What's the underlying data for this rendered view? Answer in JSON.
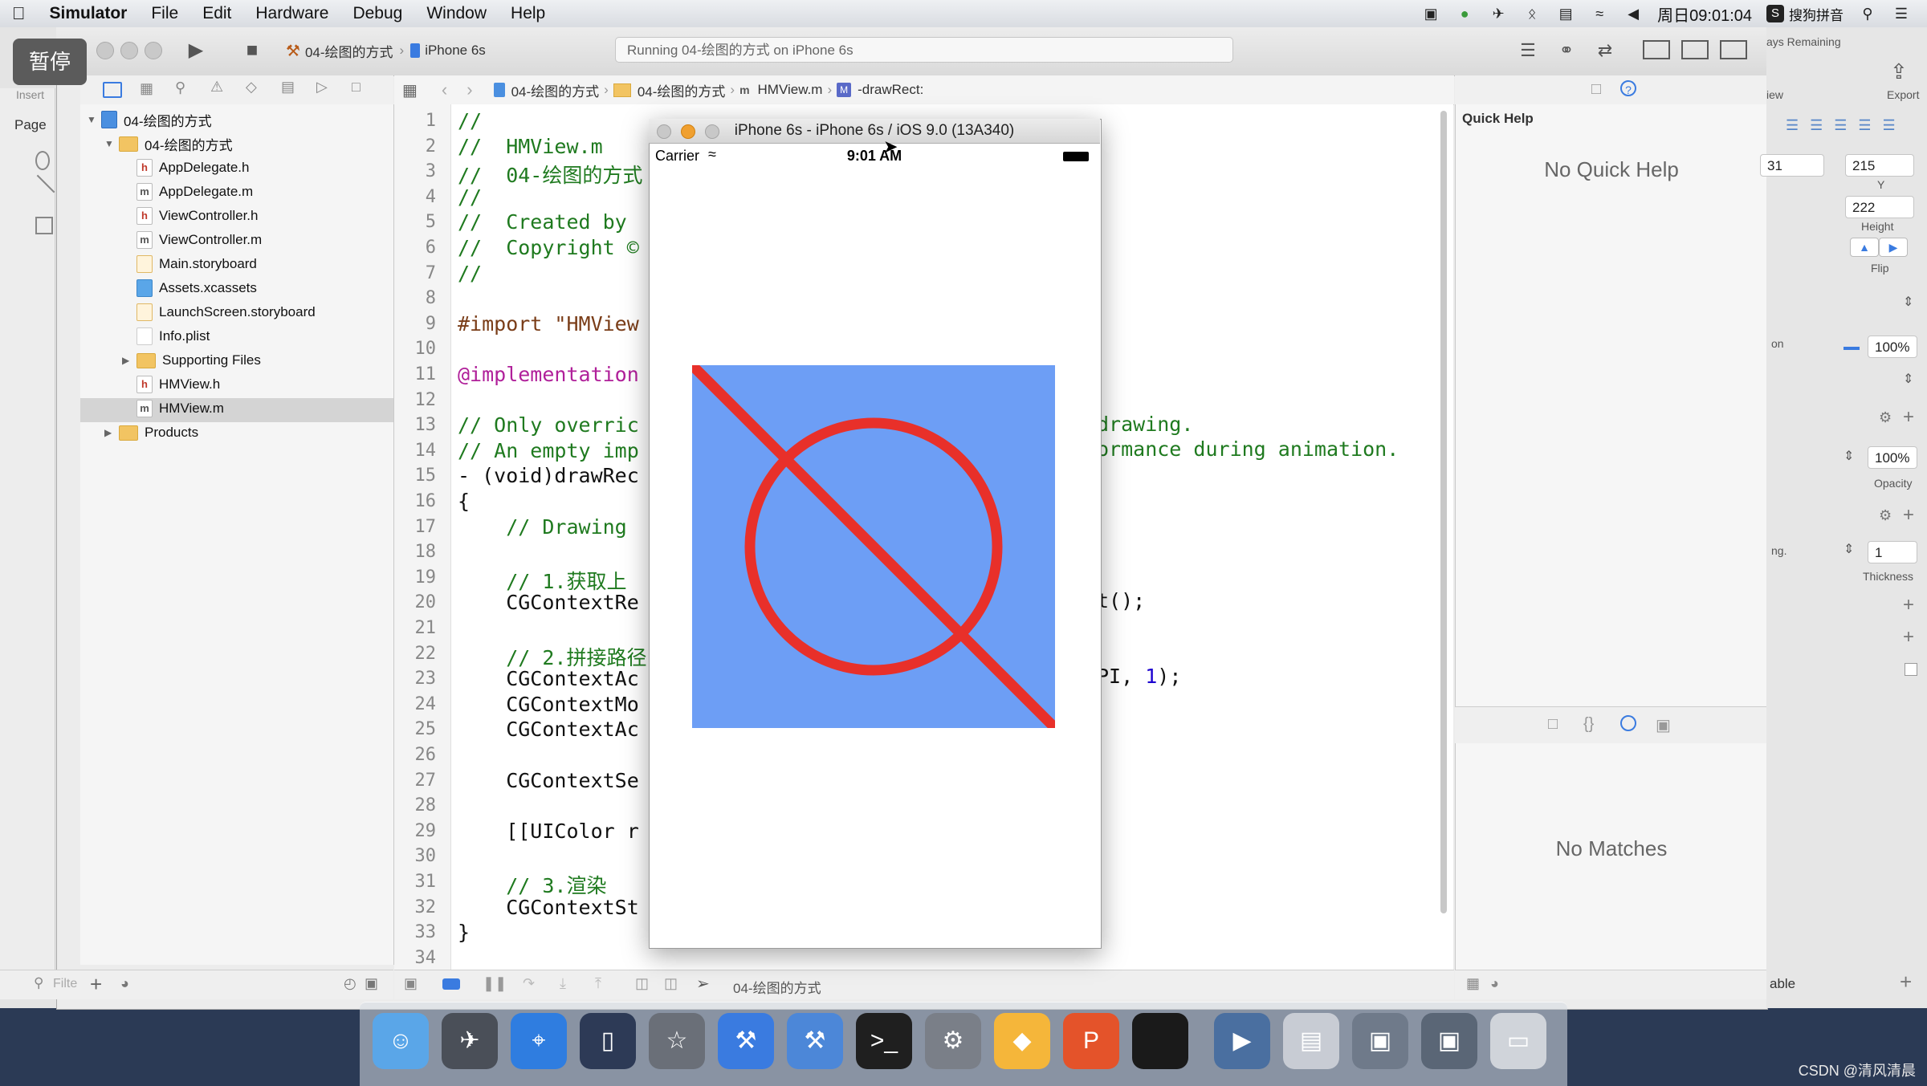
{
  "overlay": {
    "paused": "暂停"
  },
  "menubar": {
    "items": [
      "Simulator",
      "File",
      "Edit",
      "Hardware",
      "Debug",
      "Window",
      "Help"
    ],
    "clock": "周日09:01:04",
    "input_method": "搜狗拼音"
  },
  "toolbar": {
    "scheme_project": "04-绘图的方式",
    "scheme_device": "iPhone 6s",
    "activity": "Running 04-绘图的方式 on iPhone 6s"
  },
  "jumpbar": {
    "crumbs": [
      "04-绘图的方式",
      "04-绘图的方式",
      "HMView.m",
      "-drawRect:"
    ]
  },
  "navigator": {
    "items": [
      {
        "label": "04-绘图的方式",
        "icon": "project",
        "level": 0,
        "open": true
      },
      {
        "label": "04-绘图的方式",
        "icon": "folder",
        "level": 1,
        "open": true
      },
      {
        "label": "AppDelegate.h",
        "icon": "h",
        "level": 2
      },
      {
        "label": "AppDelegate.m",
        "icon": "m",
        "level": 2
      },
      {
        "label": "ViewController.h",
        "icon": "h",
        "level": 2
      },
      {
        "label": "ViewController.m",
        "icon": "m",
        "level": 2
      },
      {
        "label": "Main.storyboard",
        "icon": "storyboard",
        "level": 2
      },
      {
        "label": "Assets.xcassets",
        "icon": "assets",
        "level": 2
      },
      {
        "label": "LaunchScreen.storyboard",
        "icon": "storyboard",
        "level": 2
      },
      {
        "label": "Info.plist",
        "icon": "plist",
        "level": 2
      },
      {
        "label": "Supporting Files",
        "icon": "folder",
        "level": 2,
        "closed": true
      },
      {
        "label": "HMView.h",
        "icon": "h",
        "level": 2
      },
      {
        "label": "HMView.m",
        "icon": "m",
        "level": 2,
        "selected": true
      },
      {
        "label": "Products",
        "icon": "folder",
        "level": 1,
        "closed": true
      }
    ],
    "filter_placeholder": "Filte"
  },
  "left_strip": {
    "insert_label": "Insert",
    "page_label": "Page"
  },
  "editor": {
    "lines": [
      "//",
      "//  HMView.m",
      "//  04-绘图的方式",
      "//",
      "//  Created by",
      "//  Copyright ©",
      "//",
      "",
      "#import \"HMView",
      "",
      "@implementation",
      "",
      "// Only overric",
      "// An empty imp",
      "- (void)drawRec",
      "{",
      "    // Drawing",
      "",
      "    // 1.获取上",
      "    CGContextRe",
      "",
      "    // 2.拼接路径",
      "    CGContextAc",
      "    CGContextMo",
      "    CGContextAc",
      "",
      "    CGContextSe",
      "",
      "    [[UIColor r",
      "",
      "    // 3.渲染",
      "    CGContextSt",
      "}",
      ""
    ],
    "right_fragments": {
      "line13": "drawing.",
      "line14": "ormance during animation.",
      "line20": "t();",
      "line23_a": "PI, ",
      "line23_b": "1",
      "line23_c": ");"
    },
    "bottom_target": "04-绘图的方式"
  },
  "inspector": {
    "title": "Quick Help",
    "empty": "No Quick Help",
    "library_empty": "No Matches"
  },
  "right_panel": {
    "days_remaining": "ays Remaining",
    "export_label": "Export",
    "view_label": "iew",
    "x_value": "31",
    "y_value": "215",
    "y_label": "Y",
    "height_value": "222",
    "height_label": "Height",
    "flip_label": "Flip",
    "on_label": "on",
    "scale_1": "100%",
    "scale_2": "100%",
    "opacity_label": "Opacity",
    "thickness_value": "1",
    "thickness_label": "Thickness",
    "ng_label": "ng.",
    "able_label": "able"
  },
  "simulator": {
    "title": "iPhone 6s - iPhone 6s / iOS 9.0 (13A340)",
    "carrier": "Carrier",
    "time": "9:01 AM",
    "drawing": {
      "background": "#6d9ef5",
      "stroke": "#e8302a"
    }
  },
  "watermark": "CSDN @清风清晨",
  "dock": {
    "apps": [
      "finder-icon",
      "launchpad-icon",
      "safari-icon",
      "mouse-icon",
      "photo-icon",
      "xcode-icon",
      "instruments-icon",
      "terminal-icon",
      "system-preferences-icon",
      "sketch-icon",
      "powerpoint-icon",
      "console-icon",
      "quicktime-icon",
      "preview-icon",
      "simulator-icon",
      "simulator2-icon",
      "trash-icon"
    ]
  }
}
